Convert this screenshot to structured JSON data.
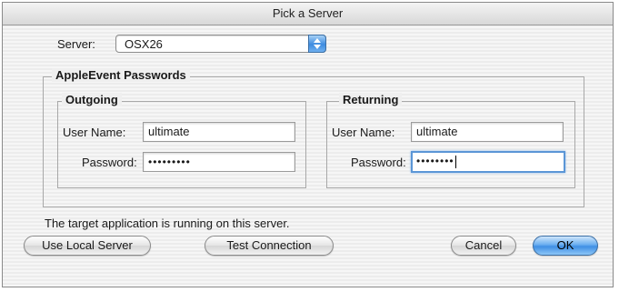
{
  "window": {
    "title": "Pick a Server"
  },
  "server": {
    "label": "Server:",
    "selected": "OSX26"
  },
  "passwords_group": {
    "title": "AppleEvent Passwords"
  },
  "outgoing": {
    "title": "Outgoing",
    "username_label": "User Name:",
    "username_value": "ultimate",
    "password_label": "Password:",
    "password_value": "•••••••••"
  },
  "returning": {
    "title": "Returning",
    "username_label": "User Name:",
    "username_value": "ultimate",
    "password_label": "Password:",
    "password_value": "••••••••"
  },
  "status_text": "The target application is running on this server.",
  "buttons": {
    "use_local": "Use Local Server",
    "test_connection": "Test Connection",
    "cancel": "Cancel",
    "ok": "OK"
  },
  "colors": {
    "accent": "#3f8fe4",
    "focus_ring": "#5b96d6"
  },
  "icons": {
    "popup_arrows": "up-down-arrows-icon"
  }
}
